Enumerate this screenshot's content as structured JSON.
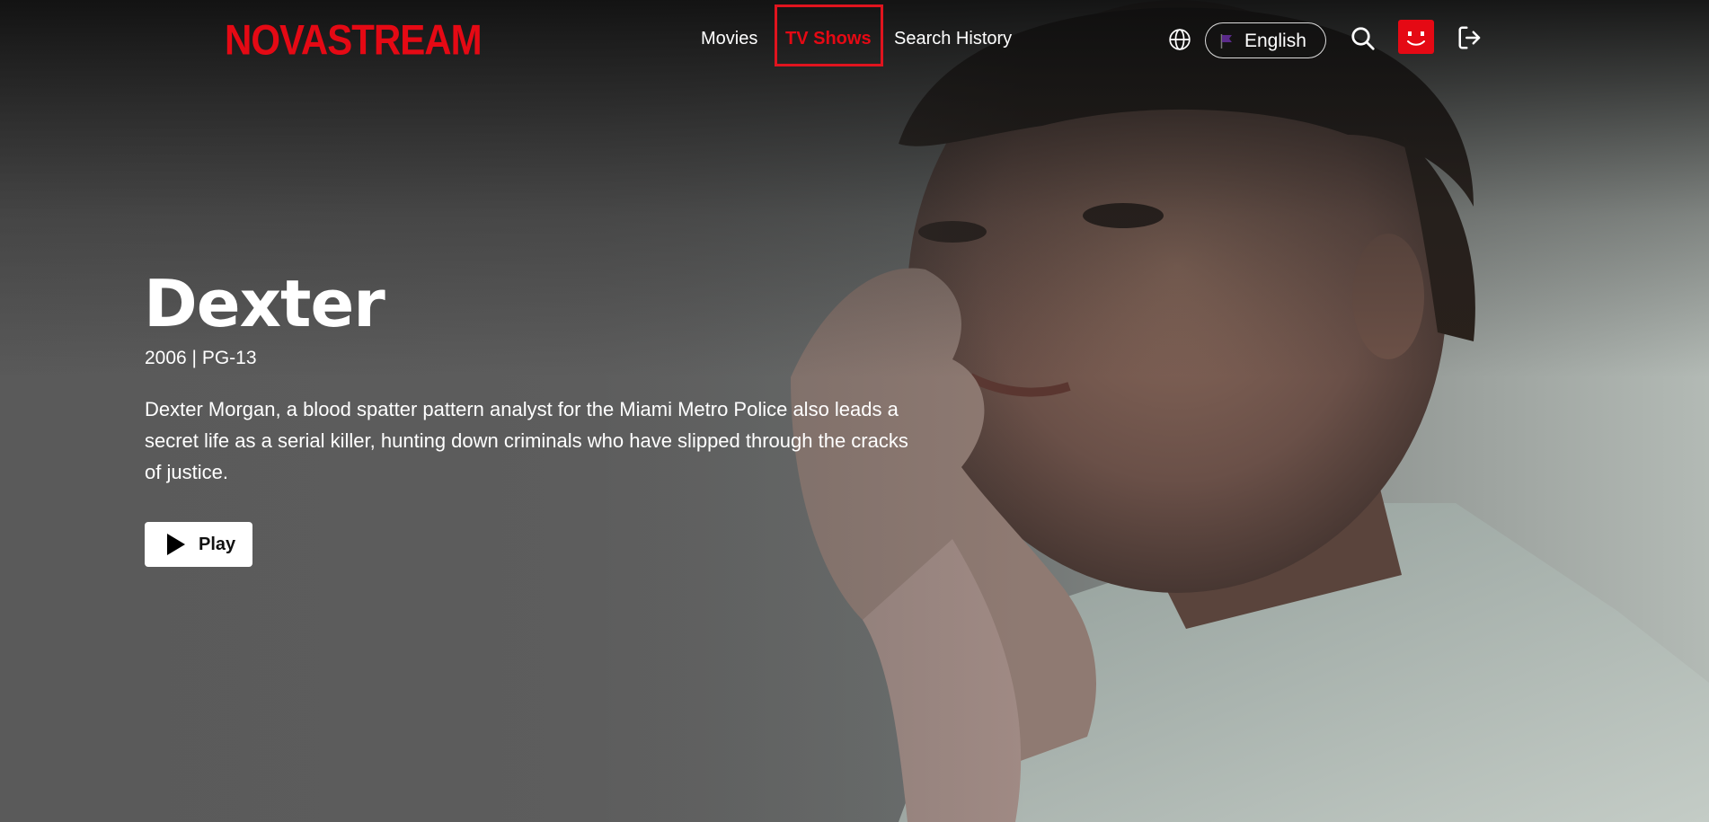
{
  "brand": {
    "name": "NOVASTREAM",
    "color": "#e50914"
  },
  "nav": {
    "links": [
      {
        "label": "Movies",
        "active": false
      },
      {
        "label": "TV Shows",
        "active": true
      },
      {
        "label": "Search History",
        "active": false
      }
    ]
  },
  "header_actions": {
    "globe_icon": "globe-icon",
    "language_label": "English",
    "language_flag_icon": "flag-icon",
    "search_icon": "search-icon",
    "avatar_icon": "profile-avatar-icon",
    "logout_icon": "logout-icon"
  },
  "hero": {
    "title": "Dexter",
    "meta": "2006 | PG-13",
    "description": "Dexter Morgan, a blood spatter pattern analyst for the Miami Metro Police also leads a secret life as a serial killer, hunting down criminals who have slipped through the cracks of justice.",
    "play_label": "Play",
    "play_icon": "play-icon"
  }
}
